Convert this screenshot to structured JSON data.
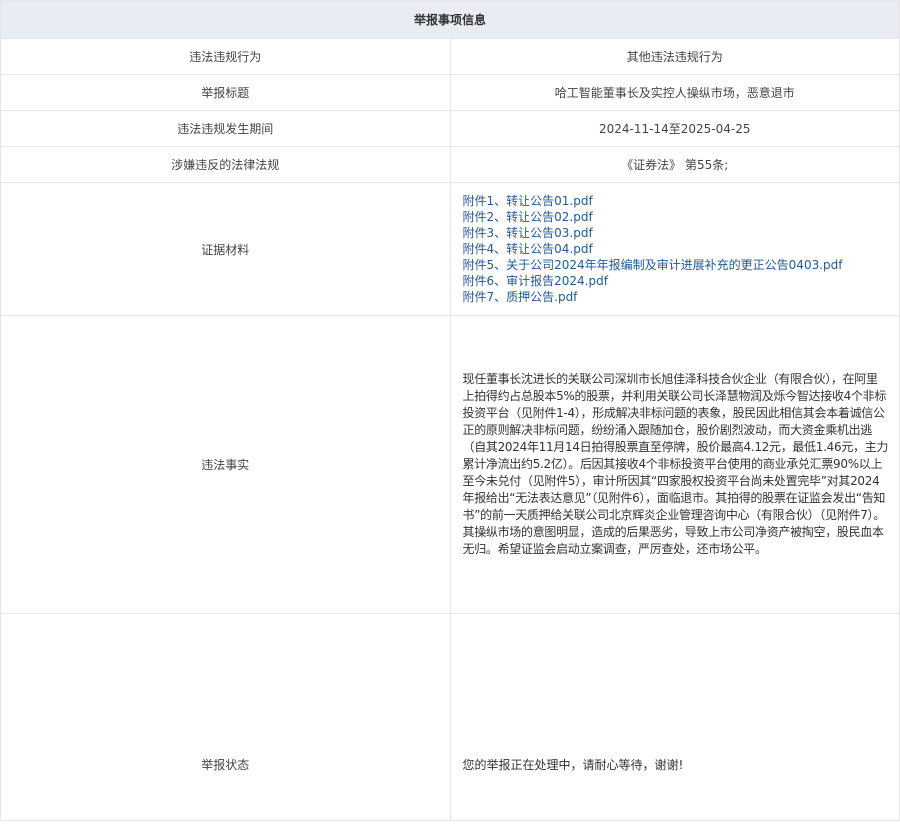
{
  "section_title": "举报事项信息",
  "rows": {
    "violation_type": {
      "label": "违法违规行为",
      "value": "其他违法违规行为"
    },
    "report_title": {
      "label": "举报标题",
      "value": "哈工智能董事长及实控人操纵市场，恶意退市"
    },
    "violation_period": {
      "label": "违法违规发生期间",
      "value": "2024-11-14至2025-04-25"
    },
    "laws_involved": {
      "label": "涉嫌违反的法律法规",
      "value": "《证券法》 第55条;"
    },
    "evidence": {
      "label": "证据材料",
      "attachments": [
        "附件1、转让公告01.pdf",
        "附件2、转让公告02.pdf",
        "附件3、转让公告03.pdf",
        "附件4、转让公告04.pdf",
        "附件5、关于公司2024年年报编制及审计进展补充的更正公告0403.pdf",
        "附件6、审计报告2024.pdf",
        "附件7、质押公告.pdf"
      ]
    },
    "facts": {
      "label": "违法事实",
      "value": "现任董事长沈进长的关联公司深圳市长旭佳泽科技合伙企业（有限合伙），在阿里上拍得约占总股本5%的股票，并利用关联公司长泽慧物润及烁今智达接收4个非标投资平台（见附件1-4），形成解决非标问题的表象，股民因此相信其会本着诚信公正的原则解决非标问题，纷纷涌入跟随加仓，股价剧烈波动，而大资金乘机出逃（自其2024年11月14日拍得股票直至停牌，股价最高4.12元，最低1.46元，主力累计净流出约5.2亿）。后因其接收4个非标投资平台使用的商业承兑汇票90%以上至今未兑付（见附件5），审计所因其“四家股权投资平台尚未处置完毕”对其2024年报给出“无法表达意见”（见附件6），面临退市。其拍得的股票在证监会发出“告知书”的前一天质押给关联公司北京辉炎企业管理咨询中心（有限合伙）（见附件7）。其操纵市场的意图明显，造成的后果恶劣，导致上市公司净资产被掏空，股民血本无归。希望证监会启动立案调查，严厉查处，还市场公平。"
    },
    "status": {
      "label": "举报状态",
      "value": "您的举报正在处理中，请耐心等待，谢谢!"
    }
  }
}
